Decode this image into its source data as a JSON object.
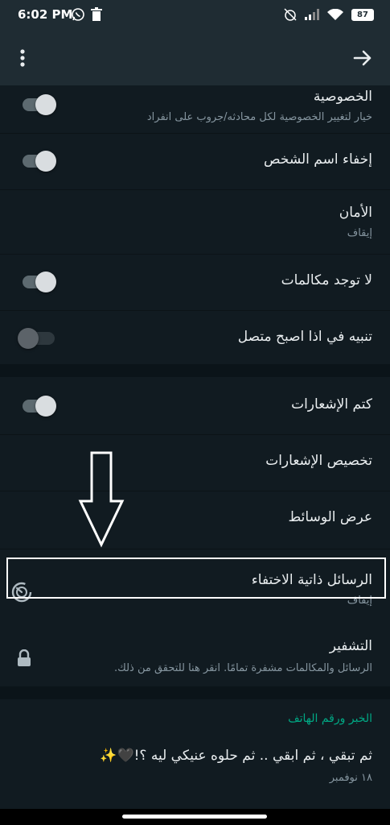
{
  "status": {
    "time": "6:02 PM",
    "battery": "87"
  },
  "header": {
    "menu_icon": "more-vert-icon",
    "back_icon": "arrow-forward-icon"
  },
  "settings": {
    "privacy_title": "الخصوصية",
    "privacy_sub": "خيار لتغيير الخصوصية لكل محادثه/جروب على انفراد",
    "hide_name_title": "إخفاء اسم الشخص",
    "security_title": "الأمان",
    "security_sub": "إيقاف",
    "no_calls_title": "لا توجد مكالمات",
    "online_alert_title": "تنبيه في اذا اصبح متصل",
    "mute_title": "كتم الإشعارات",
    "custom_notif_title": "تخصيص الإشعارات",
    "media_title": "عرض الوسائط",
    "disappearing_title": "الرسائل ذاتية الاختفاء",
    "disappearing_sub": "إيقاف",
    "encryption_title": "التشفير",
    "encryption_sub": "الرسائل والمكالمات مشفرة تمامًا. انقر هنا للتحقق من ذلك."
  },
  "toggles": {
    "privacy": true,
    "hide_name": true,
    "no_calls": true,
    "online_alert": false,
    "mute": true
  },
  "contact": {
    "section_title": "الخبر ورقم الهاتف",
    "about": "ثم تبقي ، ثم ابقي .. ثم حلوه عنيكي ليه ؟!🖤✨",
    "date": "١٨ نوفمبر"
  },
  "colors": {
    "accent": "#00a884",
    "background": "#111b21",
    "header": "#1f2c33"
  }
}
